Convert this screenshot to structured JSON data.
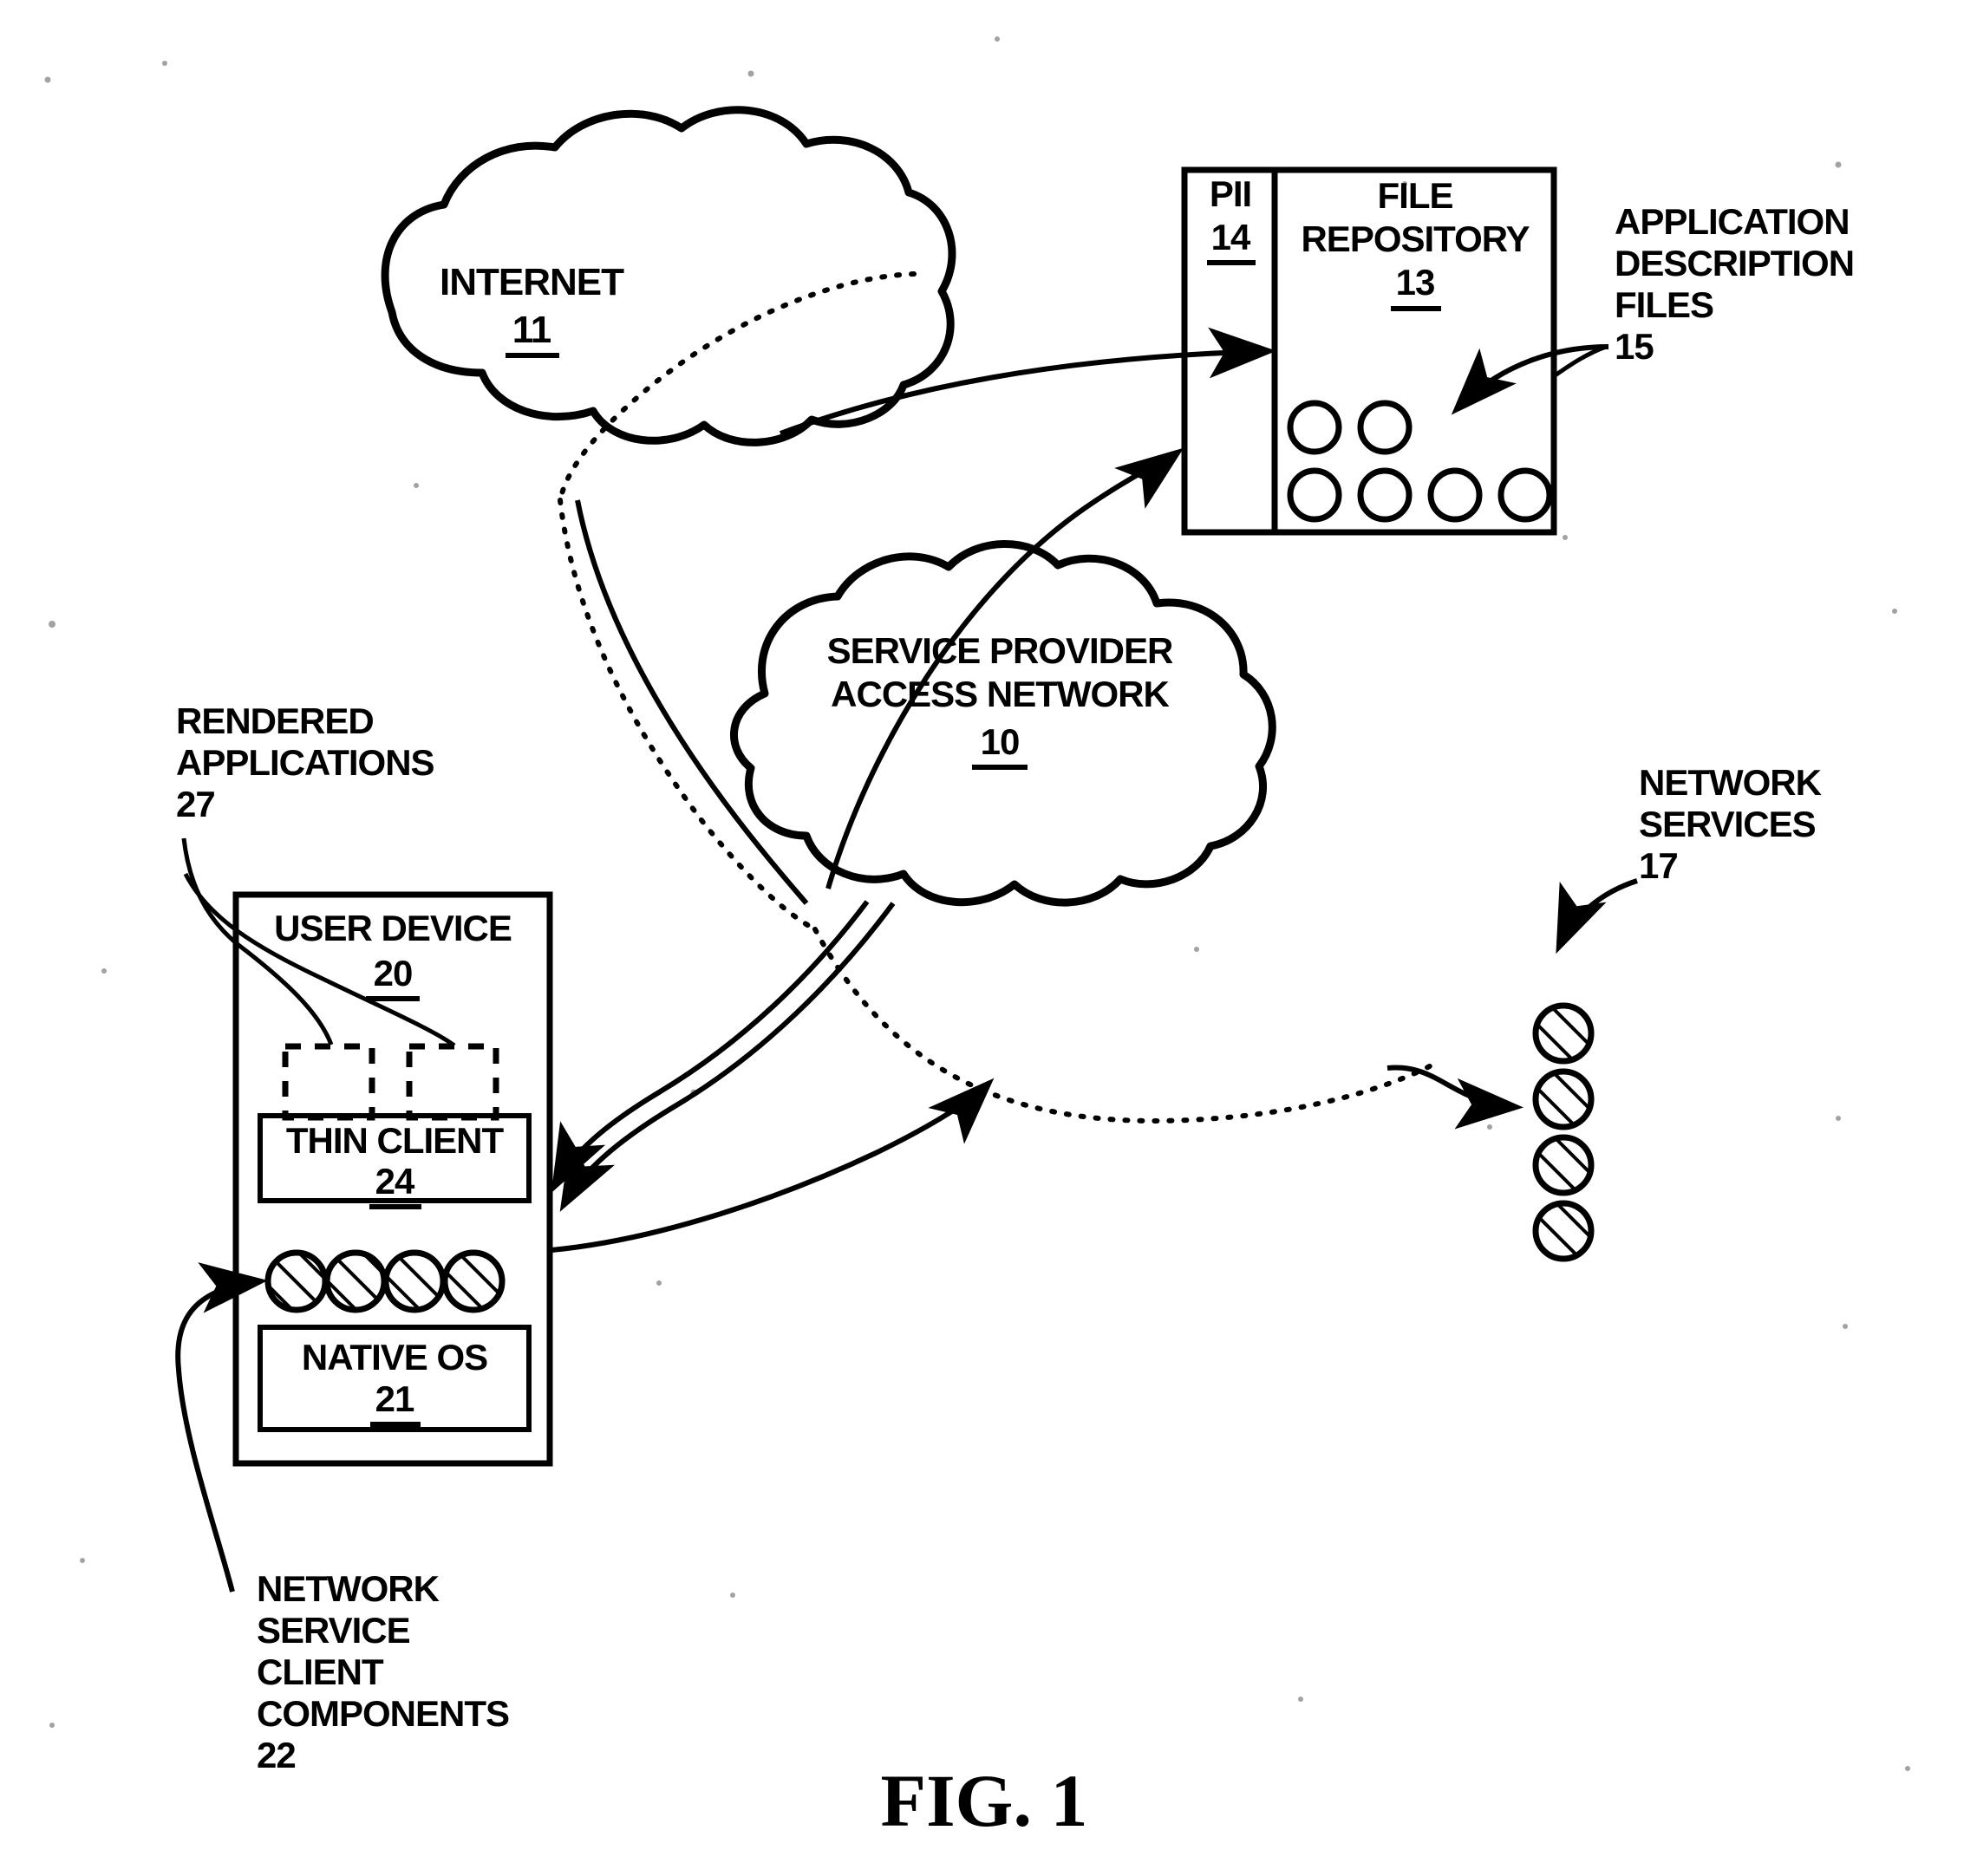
{
  "figure": {
    "caption": "FIG. 1",
    "title": "Patent drawing: service provider access network architecture"
  },
  "nodes": {
    "internet": {
      "name": "INTERNET",
      "ref": "11",
      "shape": "cloud"
    },
    "service_provider": {
      "name_line1": "SERVICE PROVIDER",
      "name_line2": "ACCESS NETWORK",
      "ref": "10",
      "shape": "cloud"
    },
    "pii": {
      "name": "PII",
      "ref": "14",
      "shape": "box-column"
    },
    "file_repository": {
      "name_line1": "FILE",
      "name_line2": "REPOSITORY",
      "ref": "13",
      "shape": "box"
    },
    "user_device": {
      "name": "USER DEVICE",
      "ref": "20",
      "shape": "box"
    },
    "thin_client": {
      "name": "THIN CLIENT",
      "ref": "24",
      "shape": "box"
    },
    "native_os": {
      "name": "NATIVE OS",
      "ref": "21",
      "shape": "box"
    }
  },
  "callouts": {
    "application_description_files": {
      "lines": [
        "APPLICATION",
        "DESCRIPTION",
        "FILES"
      ],
      "ref": "15"
    },
    "network_services": {
      "lines": [
        "NETWORK",
        "SERVICES"
      ],
      "ref": "17"
    },
    "rendered_applications": {
      "lines": [
        "RENDERED",
        "APPLICATIONS"
      ],
      "ref": "27"
    },
    "network_service_client_components": {
      "lines": [
        "NETWORK",
        "SERVICE",
        "CLIENT",
        "COMPONENTS"
      ],
      "ref": "22"
    }
  },
  "glyphs": {
    "repository_file_circles_row1": 2,
    "repository_file_circles_row2": 4,
    "network_service_client_component_circles": 4,
    "network_service_circles": 4,
    "rendered_application_placeholders": 2
  },
  "colors": {
    "ink": "#000000",
    "paper": "#ffffff"
  }
}
